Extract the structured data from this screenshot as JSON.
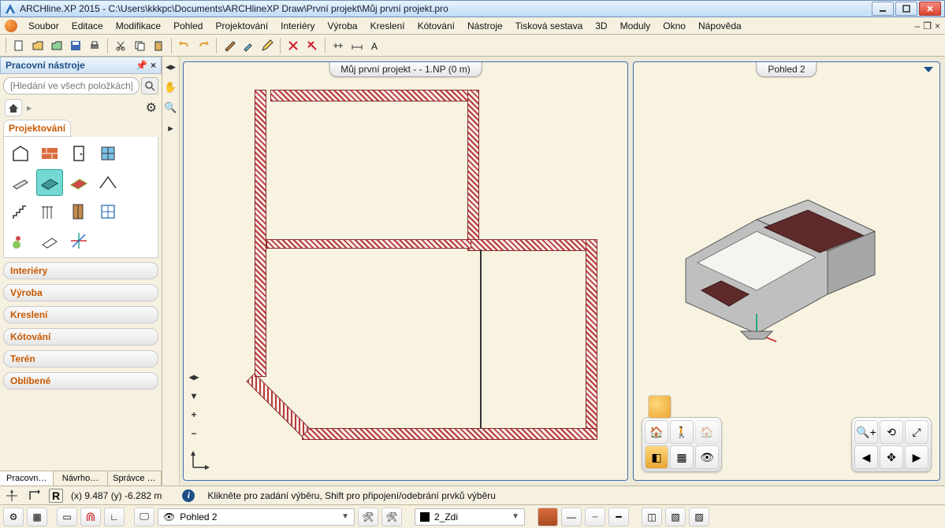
{
  "titlebar": {
    "title": "ARCHline.XP 2015 - C:\\Users\\kkkpc\\Documents\\ARCHlineXP Draw\\První projekt\\Můj první projekt.pro"
  },
  "menu": {
    "items": [
      "Soubor",
      "Editace",
      "Modifikace",
      "Pohled",
      "Projektování",
      "Interiéry",
      "Výroba",
      "Kreslení",
      "Kótování",
      "Nástroje",
      "Tisková sestava",
      "3D",
      "Moduly",
      "Okno",
      "Nápověda"
    ]
  },
  "panel": {
    "header": "Pracovní nástroje",
    "search_placeholder": "[Hledání ve všech položkách]",
    "categories": {
      "active": "Projektování",
      "others": [
        "Interiéry",
        "Výroba",
        "Kreslení",
        "Kótování",
        "Terén",
        "Oblíbené"
      ]
    },
    "bottom_tabs": [
      "Pracovn…",
      "Návrho…",
      "Správce …"
    ]
  },
  "views": {
    "view2d_tab": "Můj první projekt -  - 1.NP (0 m)",
    "view3d_tab": "Pohled 2"
  },
  "status": {
    "coords": "(x) 9.487   (y) -6.282 m",
    "hint": "Klikněte pro zadání výběru, Shift pro připojení/odebrání prvků výběru"
  },
  "propbar": {
    "view_combo": "Pohled 2",
    "layer_combo": "2_Zdi"
  }
}
